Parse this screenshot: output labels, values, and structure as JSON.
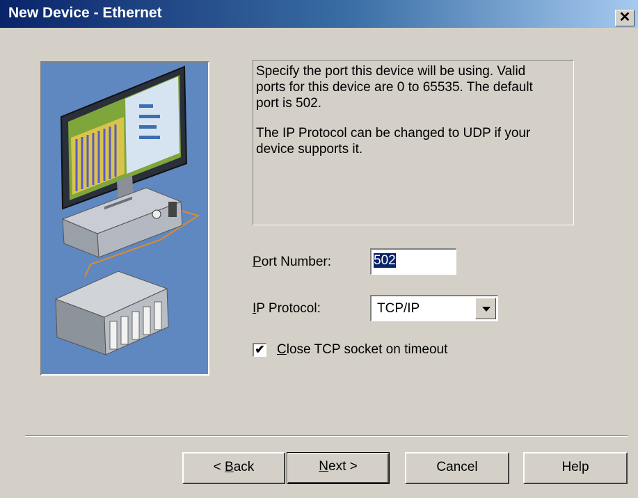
{
  "window": {
    "title": "New Device - Ethernet",
    "close_glyph": "✕"
  },
  "illustration": {
    "name": "pc-plc-network-illustration"
  },
  "description": {
    "line1": "Specify the port this device will be using.  Valid\nports for this device are 0 to 65535. The default\nport is 502.",
    "line2": "The IP Protocol can be changed to UDP if your\ndevice supports it."
  },
  "port": {
    "label_accel": "P",
    "label_rest": "ort Number:",
    "value": "502"
  },
  "protocol": {
    "label_accel": "I",
    "label_rest": "P Protocol:",
    "value": "TCP/IP"
  },
  "close_socket": {
    "checked": true,
    "label_accel": "C",
    "label_rest": "lose TCP socket on timeout"
  },
  "buttons": {
    "back_prefix": "< ",
    "back_accel": "B",
    "back_rest": "ack",
    "next_accel": "N",
    "next_rest": "ext >",
    "cancel": "Cancel",
    "help": "Help"
  },
  "colors": {
    "titlebar_start": "#0a246a",
    "titlebar_end": "#a6caf0",
    "dialog_bg": "#d4d0c8",
    "illustration_bg": "#5f88c0"
  }
}
